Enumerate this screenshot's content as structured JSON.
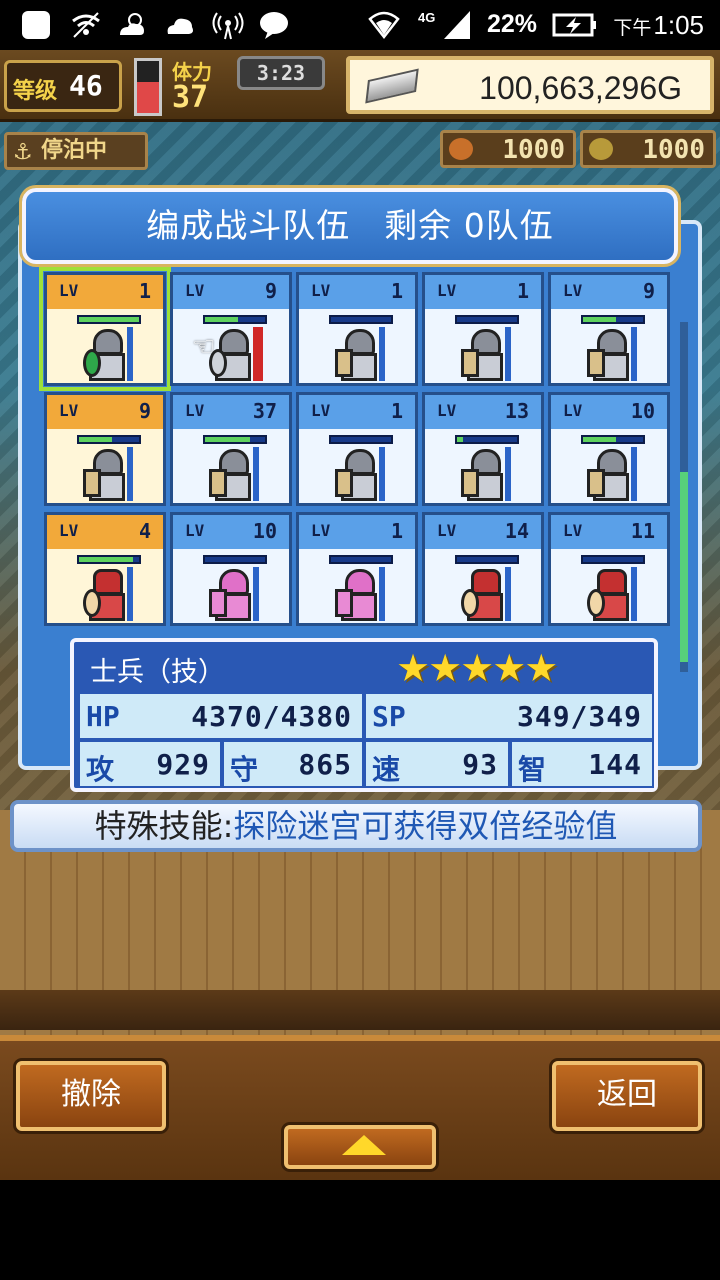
{
  "status_bar": {
    "network": "4G",
    "battery_percent": "22%",
    "time_ampm": "下午",
    "time": "1:05",
    "icons": [
      "square-icon",
      "wifi-warning-icon",
      "weather-sun-icon",
      "cloud-icon",
      "signal-broadcast-icon",
      "chat-bubble-icon",
      "wifi-icon",
      "cell-signal-icon",
      "battery-charging-icon"
    ]
  },
  "hud": {
    "level_label": "等级",
    "level": "46",
    "stamina_label": "体力",
    "stamina": "37",
    "stamina_fill": 0.6,
    "timer": "3:23",
    "gold": "100,663,296G",
    "mooring": "停泊中",
    "resource_1": "1000",
    "resource_2": "1000"
  },
  "dialog": {
    "title": "编成战斗队伍　剩余 0队伍",
    "lv_label": "LV"
  },
  "units": [
    {
      "lv": "1",
      "hp": 1.0,
      "style": "green",
      "gold": true,
      "selected": true
    },
    {
      "lv": "9",
      "hp": 0.55,
      "style": "axe",
      "gold": false,
      "selected": false
    },
    {
      "lv": "1",
      "hp": 0.0,
      "style": "knight",
      "gold": false,
      "selected": false
    },
    {
      "lv": "1",
      "hp": 0.0,
      "style": "knight",
      "gold": false,
      "selected": false
    },
    {
      "lv": "9",
      "hp": 0.55,
      "style": "knight",
      "gold": false,
      "selected": false
    },
    {
      "lv": "9",
      "hp": 0.55,
      "style": "knight",
      "gold": true,
      "selected": false
    },
    {
      "lv": "37",
      "hp": 0.75,
      "style": "knight",
      "gold": false,
      "selected": false
    },
    {
      "lv": "1",
      "hp": 0.0,
      "style": "knight",
      "gold": false,
      "selected": false
    },
    {
      "lv": "13",
      "hp": 0.1,
      "style": "knight",
      "gold": false,
      "selected": false
    },
    {
      "lv": "10",
      "hp": 0.55,
      "style": "knight",
      "gold": false,
      "selected": false
    },
    {
      "lv": "4",
      "hp": 0.9,
      "style": "red",
      "gold": true,
      "selected": false
    },
    {
      "lv": "10",
      "hp": 0.0,
      "style": "pink",
      "gold": false,
      "selected": false
    },
    {
      "lv": "1",
      "hp": 0.0,
      "style": "pink",
      "gold": false,
      "selected": false
    },
    {
      "lv": "14",
      "hp": 0.0,
      "style": "red",
      "gold": false,
      "selected": false
    },
    {
      "lv": "11",
      "hp": 0.0,
      "style": "red",
      "gold": false,
      "selected": false
    }
  ],
  "info": {
    "name": "士兵（技）",
    "stars": "★★★★★",
    "hp_label": "HP",
    "hp": "4370/4380",
    "sp_label": "SP",
    "sp": "349/349",
    "atk_label": "攻",
    "atk": "929",
    "def_label": "守",
    "def": "865",
    "spd_label": "速",
    "spd": "93",
    "int_label": "智",
    "int": "144"
  },
  "skill": {
    "label": "特殊技能:",
    "text": "探险迷宫可获得双倍经验值"
  },
  "buttons": {
    "remove": "撤除",
    "back": "返回"
  },
  "colors": {
    "panel_blue": "#3a7fd0",
    "gold_cell": "#f2a93a",
    "star": "#ffd82a",
    "hp_bar": "#5fd25f"
  }
}
